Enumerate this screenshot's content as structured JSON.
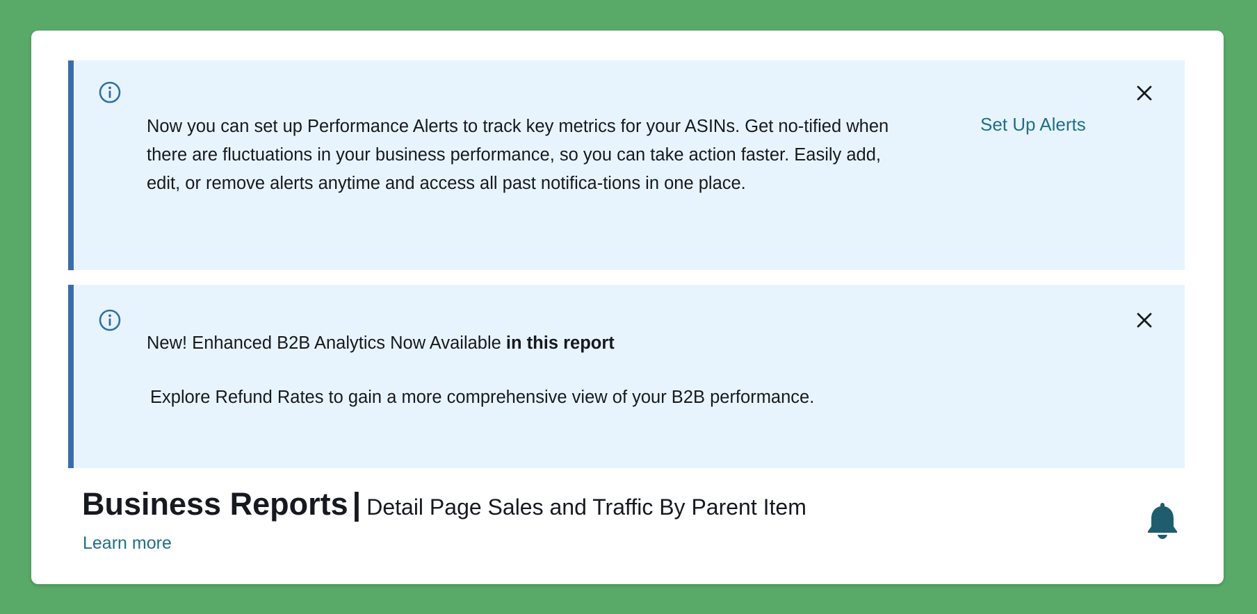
{
  "alerts": [
    {
      "icon": "info-icon",
      "text": "Now you can set up Performance Alerts to track key metrics for your ASINs. Get no-tified when there are fluctuations in your business performance, so you can take action faster. Easily add, edit, or remove alerts anytime and access all past notifica-tions in one place.",
      "link_label": "Set Up Alerts",
      "close_icon": "close-icon"
    },
    {
      "icon": "info-icon",
      "title_normal": "New! Enhanced B2B Analytics Now Available ",
      "title_bold": "in this report",
      "body": "Explore Refund Rates to gain a more comprehensive view of your B2B performance.",
      "close_icon": "close-icon"
    }
  ],
  "header": {
    "title": "Business Reports",
    "separator": "|",
    "subtitle": "Detail Page Sales and Traffic By Parent Item",
    "learn_more": "Learn more",
    "bell_icon": "bell-icon"
  },
  "colors": {
    "background": "#59aa68",
    "alert_bg": "#e8f4fd",
    "alert_border": "#3b6bad",
    "link": "#1f6f87",
    "bell": "#1f5d6e"
  }
}
